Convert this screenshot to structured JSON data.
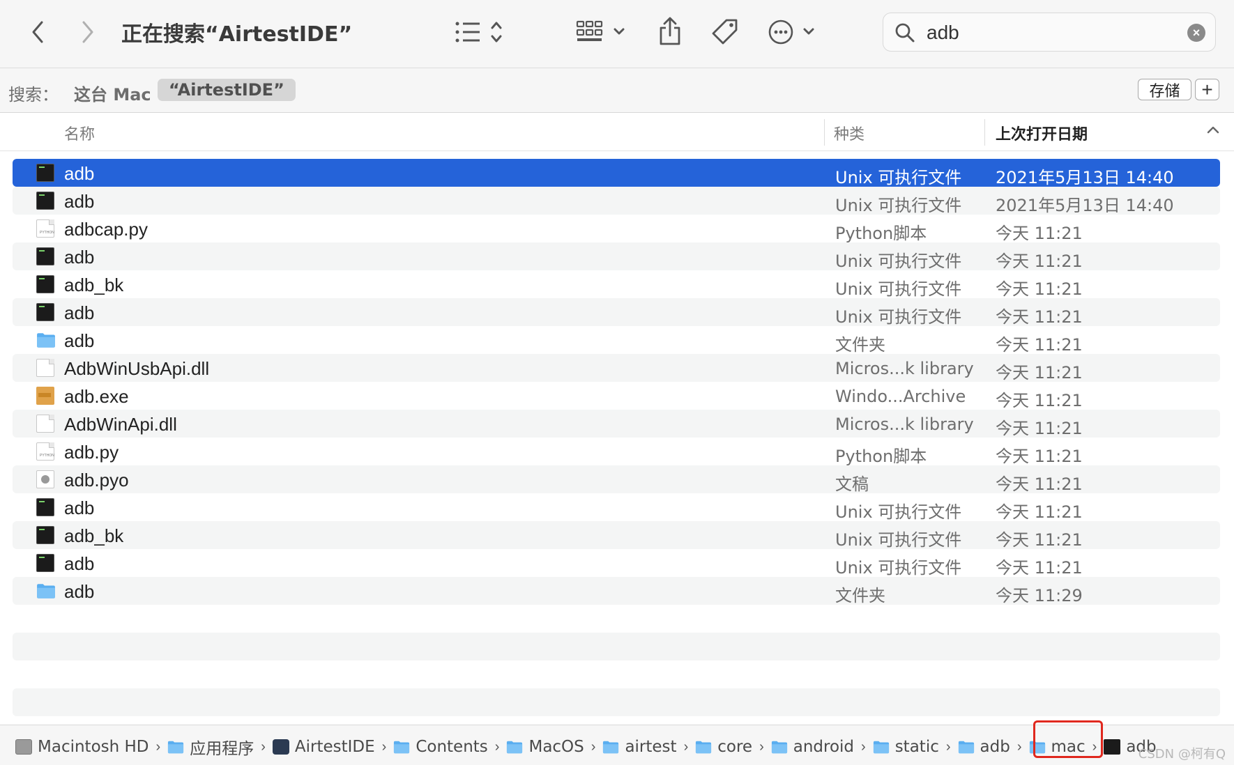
{
  "window": {
    "title": "正在搜索“AirtestIDE”"
  },
  "toolbar": {
    "back_icon": "chevron-left-icon",
    "forward_icon": "chevron-right-icon",
    "list_view_icon": "list-icon",
    "group_icon": "grid-icon",
    "share_icon": "share-icon",
    "tag_icon": "tag-icon",
    "action_icon": "ellipsis-circle-icon"
  },
  "search": {
    "value": "adb",
    "clear_symbol": "×"
  },
  "scope": {
    "label": "搜索：",
    "options": [
      "这台 Mac",
      "“AirtestIDE”"
    ],
    "save_label": "存储",
    "add_label": "+"
  },
  "columns": {
    "name": "名称",
    "kind": "种类",
    "date": "上次打开日期"
  },
  "files": [
    {
      "name": "adb",
      "kind": "Unix 可执行文件",
      "date": "2021年5月13日 14:40",
      "icon": "exec"
    },
    {
      "name": "adb",
      "kind": "Unix 可执行文件",
      "date": "2021年5月13日 14:40",
      "icon": "exec"
    },
    {
      "name": "adbcap.py",
      "kind": "Python脚本",
      "date": "今天 11:21",
      "icon": "py"
    },
    {
      "name": "adb",
      "kind": "Unix 可执行文件",
      "date": "今天 11:21",
      "icon": "exec"
    },
    {
      "name": "adb_bk",
      "kind": "Unix 可执行文件",
      "date": "今天 11:21",
      "icon": "exec"
    },
    {
      "name": "adb",
      "kind": "Unix 可执行文件",
      "date": "今天 11:21",
      "icon": "exec"
    },
    {
      "name": "adb",
      "kind": "文件夹",
      "date": "今天 11:21",
      "icon": "folder"
    },
    {
      "name": "AdbWinUsbApi.dll",
      "kind": "Micros...k library",
      "date": "今天 11:21",
      "icon": "doc"
    },
    {
      "name": "adb.exe",
      "kind": "Windo...Archive",
      "date": "今天 11:21",
      "icon": "exe"
    },
    {
      "name": "AdbWinApi.dll",
      "kind": "Micros...k library",
      "date": "今天 11:21",
      "icon": "doc"
    },
    {
      "name": "adb.py",
      "kind": "Python脚本",
      "date": "今天 11:21",
      "icon": "py"
    },
    {
      "name": "adb.pyo",
      "kind": "文稿",
      "date": "今天 11:21",
      "icon": "pyo"
    },
    {
      "name": "adb",
      "kind": "Unix 可执行文件",
      "date": "今天 11:21",
      "icon": "exec"
    },
    {
      "name": "adb_bk",
      "kind": "Unix 可执行文件",
      "date": "今天 11:21",
      "icon": "exec"
    },
    {
      "name": "adb",
      "kind": "Unix 可执行文件",
      "date": "今天 11:21",
      "icon": "exec"
    },
    {
      "name": "adb",
      "kind": "文件夹",
      "date": "今天 11:29",
      "icon": "folder"
    }
  ],
  "path": [
    {
      "label": "Macintosh HD",
      "icon": "disk"
    },
    {
      "label": "应用程序",
      "icon": "apps-folder"
    },
    {
      "label": "AirtestIDE",
      "icon": "app"
    },
    {
      "label": "Contents",
      "icon": "folder"
    },
    {
      "label": "MacOS",
      "icon": "folder"
    },
    {
      "label": "airtest",
      "icon": "folder"
    },
    {
      "label": "core",
      "icon": "folder"
    },
    {
      "label": "android",
      "icon": "folder"
    },
    {
      "label": "static",
      "icon": "folder"
    },
    {
      "label": "adb",
      "icon": "folder"
    },
    {
      "label": "mac",
      "icon": "folder"
    },
    {
      "label": "adb",
      "icon": "exec"
    }
  ],
  "watermark": "CSDN @柯有Q",
  "colors": {
    "selection": "#2563d9",
    "highlight_box": "#e0281e",
    "folder": "#5aaef0"
  }
}
